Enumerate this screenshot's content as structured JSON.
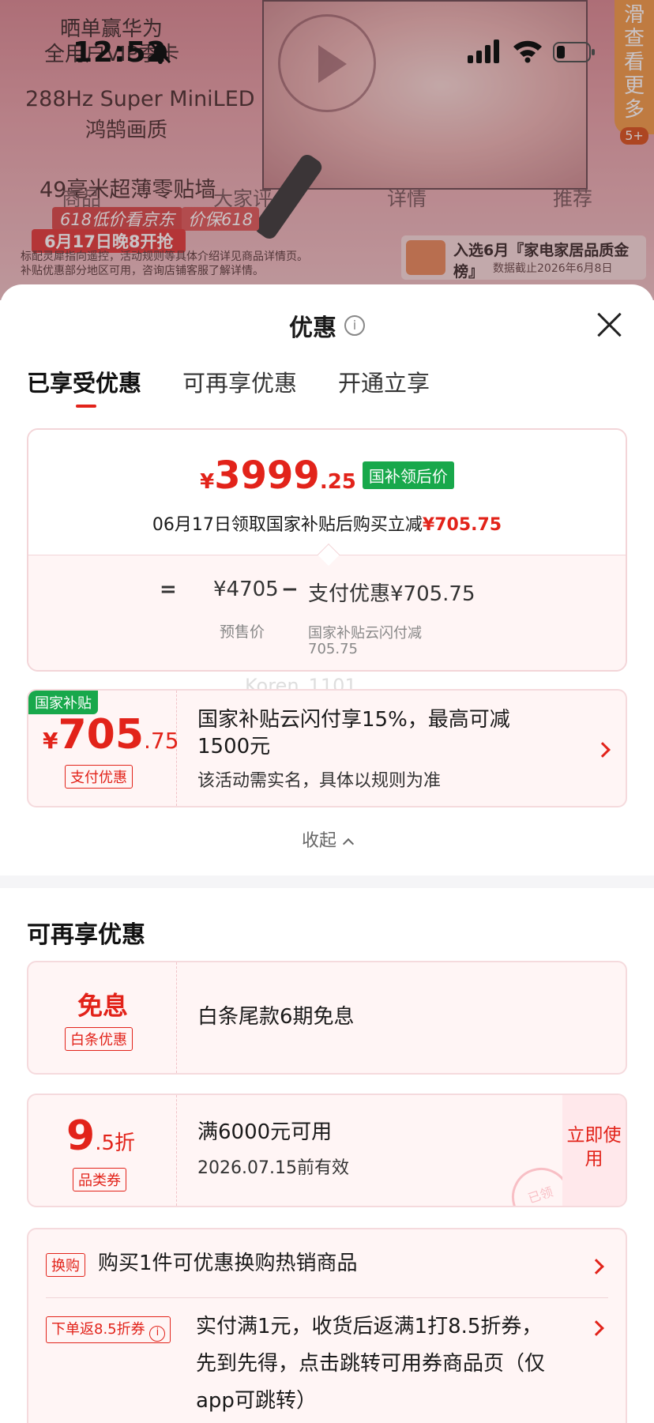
{
  "status_bar": {
    "time": "12:52"
  },
  "background": {
    "promo_line1": "晒单赢华为",
    "promo_line2": "全用户VIP季卡",
    "promo_line3": "288Hz Super MiniLED",
    "promo_line4": "鸿鹄画质",
    "promo_line5": "49毫米超薄零贴墙",
    "badge_618": "618低价看京东",
    "badge_price_protect": "价保618",
    "date_banner": "6月17日晚8开抢",
    "fine_print1": "标配灵犀指向遥控，活动规则等具体介绍详见商品详情页。",
    "fine_print2": "补贴优惠部分地区可用，咨询店铺客服了解详情。",
    "side_more": "滑查看更多",
    "side_count": "5+",
    "rank_title": "入选6月『家电家居品质金榜』",
    "rank_sub": "数据截止2026年6月8日",
    "tabs": [
      "商品",
      "大家评",
      "详情",
      "推荐"
    ]
  },
  "sheet": {
    "title": "优惠",
    "info_icon": "i",
    "tabs": [
      "已享受优惠",
      "可再享优惠",
      "开通立享"
    ],
    "price_card": {
      "currency": "¥",
      "price_int": "3999",
      "price_dec": ".25",
      "price_tag": "国补领后价",
      "desc_prefix": "06月17日领取国家补贴后购买立减",
      "desc_amount": "¥705.75",
      "eq": "=",
      "presale": "¥4705",
      "minus": "−",
      "pay_discount": "支付优惠¥705.75",
      "presale_label": "预售价",
      "pay_label1": "国家补贴云闪付减",
      "pay_label2": "705.75"
    },
    "watermark": "Koren_1101",
    "gov_coupon": {
      "tag": "国家补贴",
      "currency": "¥",
      "amount_int": "705",
      "amount_dec": ".75",
      "badge": "支付优惠",
      "title_line1": "国家补贴云闪付享15%，最高可减",
      "title_line2": "1500元",
      "sub": "该活动需实名，具体以规则为准"
    },
    "collapse": "收起",
    "more_section_title": "可再享优惠",
    "interest_free": {
      "big": "免息",
      "badge": "白条优惠",
      "title": "白条尾款6期免息"
    },
    "category_coupon": {
      "big": "9",
      "dec": ".5折",
      "badge": "品类券",
      "title": "满6000元可用",
      "sub": "2026.07.15前有效",
      "use_now": "立即使用",
      "stamp": "已领"
    },
    "exchange": {
      "tag": "换购",
      "title": "购买1件可优惠换购热销商品"
    },
    "return_coupon": {
      "tag": "下单返8.5折券",
      "text_line1": "实付满1元，收货后返满1打8.5折券，",
      "text_line2": "先到先得，点击跳转可用券商品页（仅",
      "text_line3": "app可跳转）"
    }
  }
}
